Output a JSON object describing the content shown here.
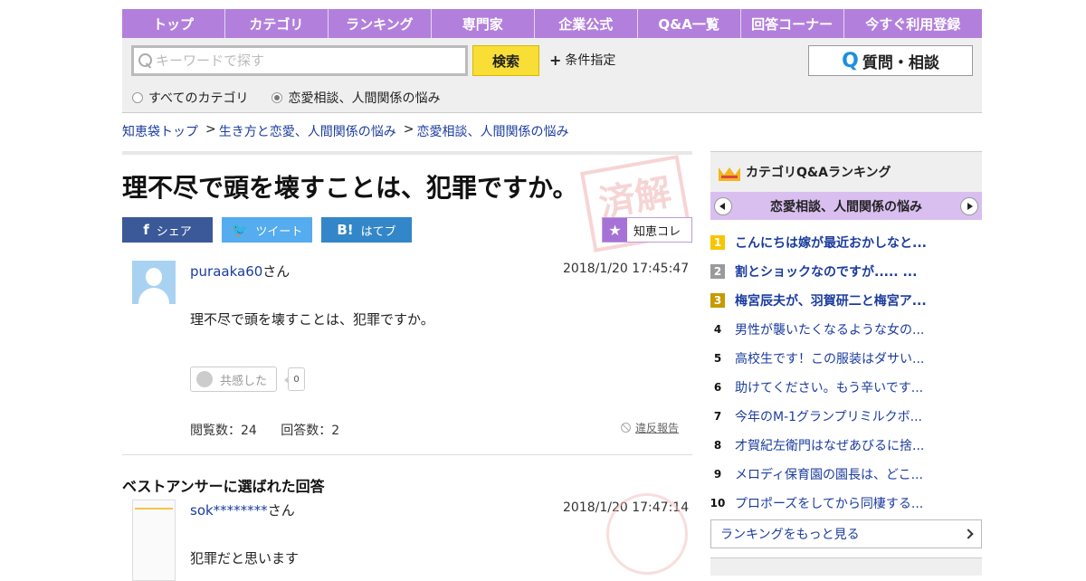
{
  "nav": [
    "トップ",
    "カテゴリ",
    "ランキング",
    "専門家",
    "企業公式",
    "Q&A一覧",
    "回答コーナー",
    "今すぐ利用登録"
  ],
  "search": {
    "placeholder": "キーワードで探す",
    "button": "検索",
    "condition": "条件指定",
    "radio_all": "すべてのカテゴリ",
    "radio_cat": "恋愛相談、人間関係の悩み",
    "ask_button": "質問・相談"
  },
  "breadcrumb": [
    "知恵袋トップ",
    "生き方と恋愛、人間関係の悩み",
    "恋愛相談、人間関係の悩み"
  ],
  "breadcrumb_sep": ">",
  "question": {
    "title": "理不尽で頭を壊すことは、犯罪ですか。",
    "stamp": "済解",
    "share_fb": "シェア",
    "share_tw": "ツイート",
    "share_hb": "はてブ",
    "chie": "知恵コレ",
    "user": "puraaka60",
    "san": "さん",
    "date": "2018/1/20  17:45:47",
    "body": "理不尽で頭を壊すことは、犯罪ですか。",
    "empathy": "共感した",
    "empathy_count": "0",
    "views": "閲覧数：24",
    "answers": "回答数：2",
    "report": "違反報告"
  },
  "best_answer": {
    "heading": "ベストアンサーに選ばれた回答",
    "user": "sok********",
    "san": "さん",
    "date": "2018/1/20  17:47:14",
    "body": "犯罪だと思います"
  },
  "sidebar": {
    "heading": "カテゴリQ&Aランキング",
    "category": "恋愛相談、人間関係の悩み",
    "ranking": [
      {
        "rank": "1",
        "text": "こんにちは嫁が最近おかしなと..."
      },
      {
        "rank": "2",
        "text": "割とショックなのですが..... ..."
      },
      {
        "rank": "3",
        "text": "梅宮辰夫が、羽賀研二と梅宮ア..."
      },
      {
        "rank": "4",
        "text": "男性が襲いたくなるような女の..."
      },
      {
        "rank": "5",
        "text": "高校生です！この服装はダサい..."
      },
      {
        "rank": "6",
        "text": "助けてください。もう辛いです..."
      },
      {
        "rank": "7",
        "text": "今年のM-1グランプリミルクボ..."
      },
      {
        "rank": "8",
        "text": "才賀紀左衛門はなぜあびるに捨..."
      },
      {
        "rank": "9",
        "text": "メロディ保育園の園長は、どこ..."
      },
      {
        "rank": "10",
        "text": "プロポーズをしてから同棲する..."
      }
    ],
    "more": "ランキングをもっと見る"
  }
}
